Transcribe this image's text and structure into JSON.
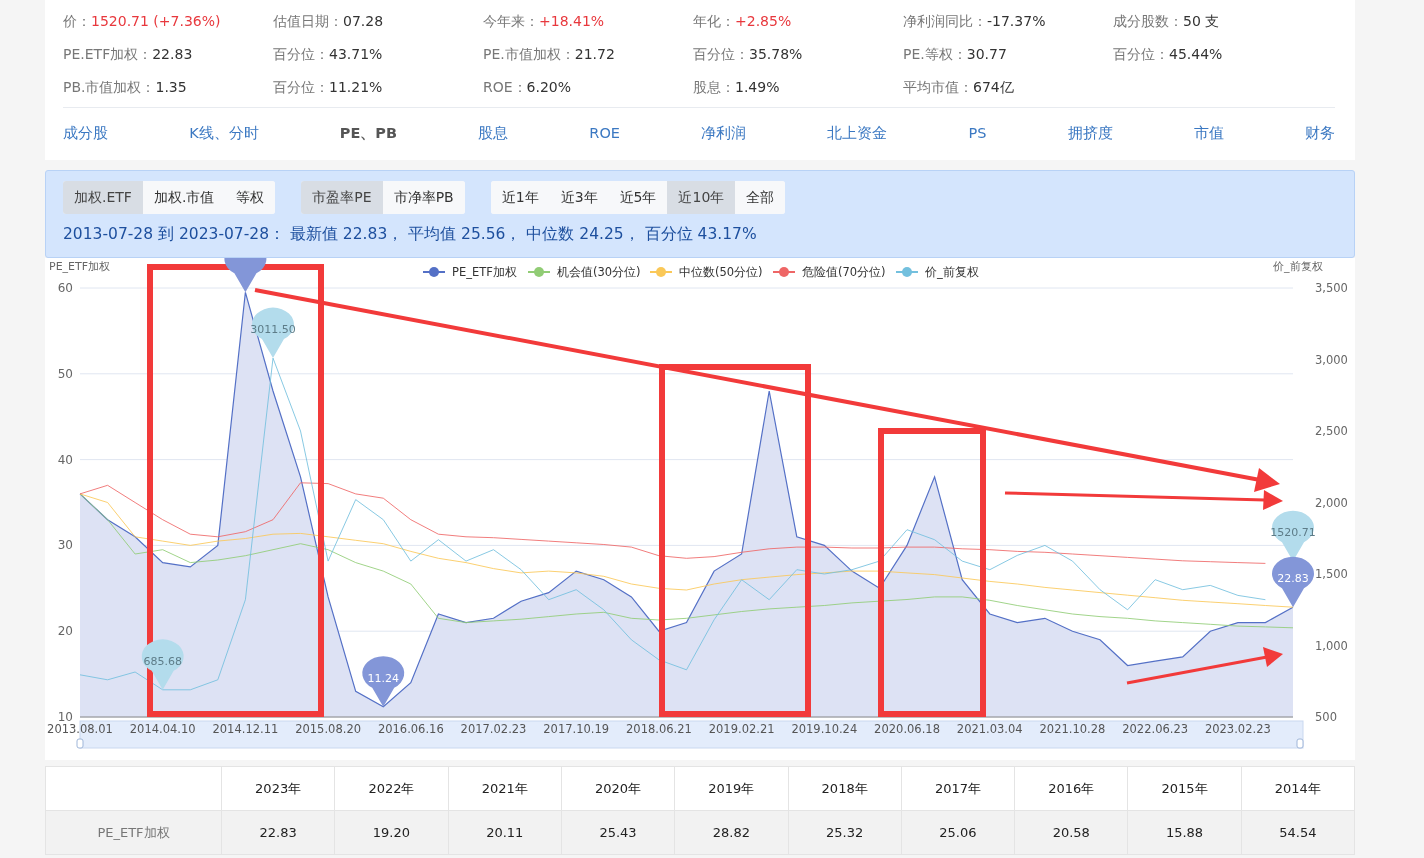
{
  "stats": [
    [
      {
        "label": "价：",
        "value": "1520.71 (+7.36%)",
        "color": "#e8383d"
      },
      {
        "label": "估值日期：",
        "value": "07.28",
        "color": "#333333"
      },
      {
        "label": "今年来：",
        "value": "+18.41%",
        "color": "#e8383d"
      },
      {
        "label": "年化：",
        "value": "+2.85%",
        "color": "#e8383d"
      },
      {
        "label": "净利润同比：",
        "value": "-17.37%",
        "color": "#333333"
      },
      {
        "label": "成分股数：",
        "value": "50 支",
        "color": "#333333"
      }
    ],
    [
      {
        "label": "PE.ETF加权：",
        "value": "22.83",
        "color": "#333333"
      },
      {
        "label": "百分位：",
        "value": "43.71%",
        "color": "#333333"
      },
      {
        "label": "PE.市值加权：",
        "value": "21.72",
        "color": "#333333"
      },
      {
        "label": "百分位：",
        "value": "35.78%",
        "color": "#333333"
      },
      {
        "label": "PE.等权：",
        "value": "30.77",
        "color": "#333333"
      },
      {
        "label": "百分位：",
        "value": "45.44%",
        "color": "#333333"
      }
    ],
    [
      {
        "label": "PB.市值加权：",
        "value": "1.35",
        "color": "#333333"
      },
      {
        "label": "百分位：",
        "value": "11.21%",
        "color": "#333333"
      },
      {
        "label": "ROE：",
        "value": "6.20%",
        "color": "#333333"
      },
      {
        "label": "股息：",
        "value": "1.49%",
        "color": "#333333"
      },
      {
        "label": "平均市值：",
        "value": "674亿",
        "color": "#333333"
      }
    ]
  ],
  "nav_tabs": [
    {
      "label": "成分股",
      "selected": false
    },
    {
      "label": "K线、分时",
      "selected": false
    },
    {
      "label": "PE、PB",
      "selected": true
    },
    {
      "label": "股息",
      "selected": false
    },
    {
      "label": "ROE",
      "selected": false
    },
    {
      "label": "净利润",
      "selected": false
    },
    {
      "label": "北上资金",
      "selected": false
    },
    {
      "label": "PS",
      "selected": false
    },
    {
      "label": "拥挤度",
      "selected": false
    },
    {
      "label": "市值",
      "selected": false
    },
    {
      "label": "财务",
      "selected": false
    }
  ],
  "filters": [
    [
      {
        "label": "加权.ETF",
        "selected": true
      },
      {
        "label": "加权.市值",
        "selected": false
      },
      {
        "label": "等权",
        "selected": false
      }
    ],
    [
      {
        "label": "市盈率PE",
        "selected": true
      },
      {
        "label": "市净率PB",
        "selected": false
      }
    ],
    [
      {
        "label": "近1年",
        "selected": false
      },
      {
        "label": "近3年",
        "selected": false
      },
      {
        "label": "近5年",
        "selected": false
      },
      {
        "label": "近10年",
        "selected": true
      },
      {
        "label": "全部",
        "selected": false
      }
    ]
  ],
  "summary": "2013-07-28 到 2023-07-28： 最新值 22.83， 平均值 25.56， 中位数 24.25， 百分位 43.17%",
  "chart": {
    "markers": [
      {
        "kind": "pe-max"
      },
      {
        "kind": "price-max",
        "text": "3011.50"
      },
      {
        "kind": "price-min",
        "text": "685.68"
      },
      {
        "kind": "pe-min",
        "text": "11.24"
      },
      {
        "kind": "price-last",
        "text": "1520.71"
      },
      {
        "kind": "pe-last",
        "text": "22.83"
      }
    ],
    "chart_data": {
      "type": "line",
      "grid": true,
      "legend": true,
      "ylabel": "PE_ETF加权",
      "y2label": "价_前复权",
      "categories": [
        "2013.08.01",
        null,
        null,
        "2014.04.10",
        null,
        null,
        "2014.12.11",
        null,
        null,
        "2015.08.20",
        null,
        null,
        "2016.06.16",
        null,
        null,
        "2017.02.23",
        null,
        null,
        "2017.10.19",
        null,
        null,
        "2018.06.21",
        null,
        null,
        "2019.02.21",
        null,
        null,
        "2019.10.24",
        null,
        null,
        "2020.06.18",
        null,
        null,
        "2021.03.04",
        null,
        null,
        "2021.10.28",
        null,
        null,
        "2022.06.23",
        null,
        null,
        "2023.02.23",
        null,
        null
      ],
      "ylim": [
        10,
        60
      ],
      "yticks": [
        10,
        20,
        30,
        40,
        50,
        60
      ],
      "y2lim": [
        500,
        3500
      ],
      "y2ticks": [
        {
          "value": 500,
          "label": "500"
        },
        {
          "value": 1000,
          "label": "1,000"
        },
        {
          "value": 1500,
          "label": "1,500"
        },
        {
          "value": 2000,
          "label": "2,000"
        },
        {
          "value": 2500,
          "label": "2,500"
        },
        {
          "value": 3000,
          "label": "3,000"
        },
        {
          "value": 3500,
          "label": "3,500"
        }
      ],
      "series": [
        {
          "name": "PE_ETF加权",
          "color": "#5470c6",
          "type": "area",
          "values": [
            36,
            33,
            31,
            28,
            27.5,
            30,
            59.5,
            48,
            38,
            24,
            13,
            11.2,
            14,
            22,
            21,
            21.5,
            23.5,
            24.5,
            27,
            26,
            24,
            20,
            21,
            27,
            29,
            48,
            31,
            30,
            27,
            25,
            30,
            38,
            26,
            22,
            21,
            21.5,
            20,
            19,
            16,
            16.5,
            17,
            20,
            21,
            21,
            22.8
          ]
        },
        {
          "name": "机会值(30分位)",
          "color": "#91cc75",
          "values": [
            36,
            33,
            29,
            29.5,
            28,
            28.3,
            28.8,
            29.5,
            30.2,
            29.5,
            28,
            27,
            25.5,
            21.5,
            21,
            21.2,
            21.4,
            21.7,
            22,
            22.2,
            21.5,
            21.3,
            21.5,
            21.9,
            22.3,
            22.6,
            22.8,
            23,
            23.3,
            23.5,
            23.7,
            24,
            24,
            23.6,
            23,
            22.5,
            22,
            21.7,
            21.5,
            21.2,
            21,
            20.8,
            20.6,
            20.5,
            20.4
          ]
        },
        {
          "name": "中位数(50分位)",
          "color": "#fac858",
          "values": [
            36,
            35,
            31,
            30.5,
            30,
            30.5,
            30.8,
            31.3,
            31.4,
            31,
            30.6,
            30.2,
            29.3,
            28.5,
            28,
            27.3,
            26.8,
            27,
            26.8,
            26.4,
            25.5,
            25,
            24.8,
            25.5,
            26,
            26.3,
            26.6,
            26.8,
            27,
            27,
            26.8,
            26.6,
            26.2,
            25.8,
            25.5,
            25.1,
            24.8,
            24.5,
            24.2,
            23.9,
            23.6,
            23.4,
            23.2,
            23,
            22.8
          ]
        },
        {
          "name": "危险值(70分位)",
          "color": "#ee6666",
          "values": [
            36,
            37,
            35,
            33,
            31.3,
            31,
            31.6,
            33,
            37.3,
            37.2,
            36,
            35.5,
            33,
            31.3,
            31,
            30.9,
            30.7,
            30.5,
            30.3,
            30.1,
            29.8,
            28.8,
            28.5,
            28.7,
            29.2,
            29.6,
            29.8,
            29.8,
            29.7,
            29.7,
            29.8,
            29.8,
            29.6,
            29.5,
            29.3,
            29.2,
            29,
            28.8,
            28.6,
            28.4,
            28.2,
            28.1,
            28,
            27.9,
            null
          ]
        },
        {
          "name": "价_前复权",
          "color": "#73c0de",
          "axis": "y2",
          "values": [
            795,
            760,
            815,
            690,
            690,
            760,
            1320,
            3010,
            2500,
            1590,
            2020,
            1880,
            1590,
            1740,
            1590,
            1670,
            1530,
            1320,
            1390,
            1250,
            1040,
            900,
            830,
            1180,
            1460,
            1320,
            1530,
            1500,
            1530,
            1590,
            1810,
            1740,
            1590,
            1530,
            1630,
            1700,
            1590,
            1390,
            1250,
            1460,
            1390,
            1420,
            1350,
            1320,
            null
          ]
        }
      ]
    }
  },
  "table": {
    "columns": [
      "2023年",
      "2022年",
      "2021年",
      "2020年",
      "2019年",
      "2018年",
      "2017年",
      "2016年",
      "2015年",
      "2014年"
    ],
    "rows": [
      {
        "label": "PE_ETF加权",
        "cells": [
          "22.83",
          "19.20",
          "20.11",
          "25.43",
          "28.82",
          "25.32",
          "25.06",
          "20.58",
          "15.88",
          "54.54"
        ]
      }
    ]
  }
}
